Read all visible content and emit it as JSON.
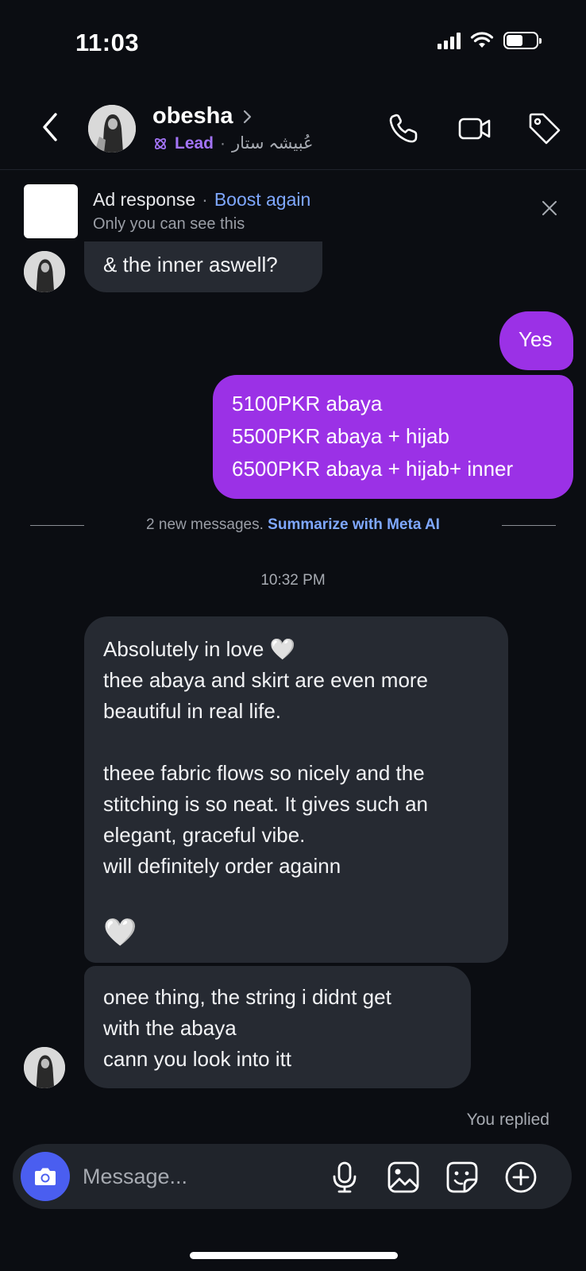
{
  "status_bar": {
    "time": "11:03",
    "icons": [
      "cellular-signal-icon",
      "wifi-icon",
      "battery-icon"
    ]
  },
  "header": {
    "name": "obesha",
    "label": "Lead",
    "separator": "·",
    "handle": "عُبیشہ ستار",
    "actions": [
      "phone-icon",
      "video-call-icon",
      "tag-icon"
    ]
  },
  "ad_banner": {
    "title": "Ad response",
    "dot": "·",
    "boost": "Boost again",
    "subtitle": "Only you can see this"
  },
  "messages": {
    "in_1": {
      "lines": [
        "& the inner aswell?"
      ]
    },
    "out_1": {
      "lines": [
        "Yes"
      ]
    },
    "out_2": {
      "lines": [
        "5100PKR abaya",
        "5500PKR abaya + hijab",
        "6500PKR abaya + hijab+ inner"
      ]
    },
    "in_2": {
      "lines": [
        "Absolutely in love 🤍",
        "thee abaya and skirt are even more",
        "beautiful in real life.",
        "",
        "theee fabric flows so nicely and the",
        "stitching is so neat. It gives such an",
        "elegant, graceful vibe.",
        "will definitely order againn",
        "",
        "🤍"
      ]
    },
    "in_3": {
      "lines": [
        "onee thing, the string i didnt get",
        "with the abaya",
        "cann you look into itt"
      ]
    }
  },
  "divider": {
    "text": "2 new messages.",
    "link": "Summarize with Meta AI"
  },
  "timestamp": "10:32 PM",
  "replied_label": "You replied",
  "composer": {
    "placeholder": "Message...",
    "icons": [
      "camera-icon",
      "microphone-icon",
      "gallery-icon",
      "sticker-icon",
      "plus-icon"
    ]
  },
  "colors": {
    "background": "#0b0d12",
    "incoming_bubble": "#262a32",
    "outgoing_bubble": "#9b31e6",
    "lead_accent": "#a374f6",
    "link_blue": "#7fa8ff",
    "camera_button": "#4a5ef0"
  }
}
